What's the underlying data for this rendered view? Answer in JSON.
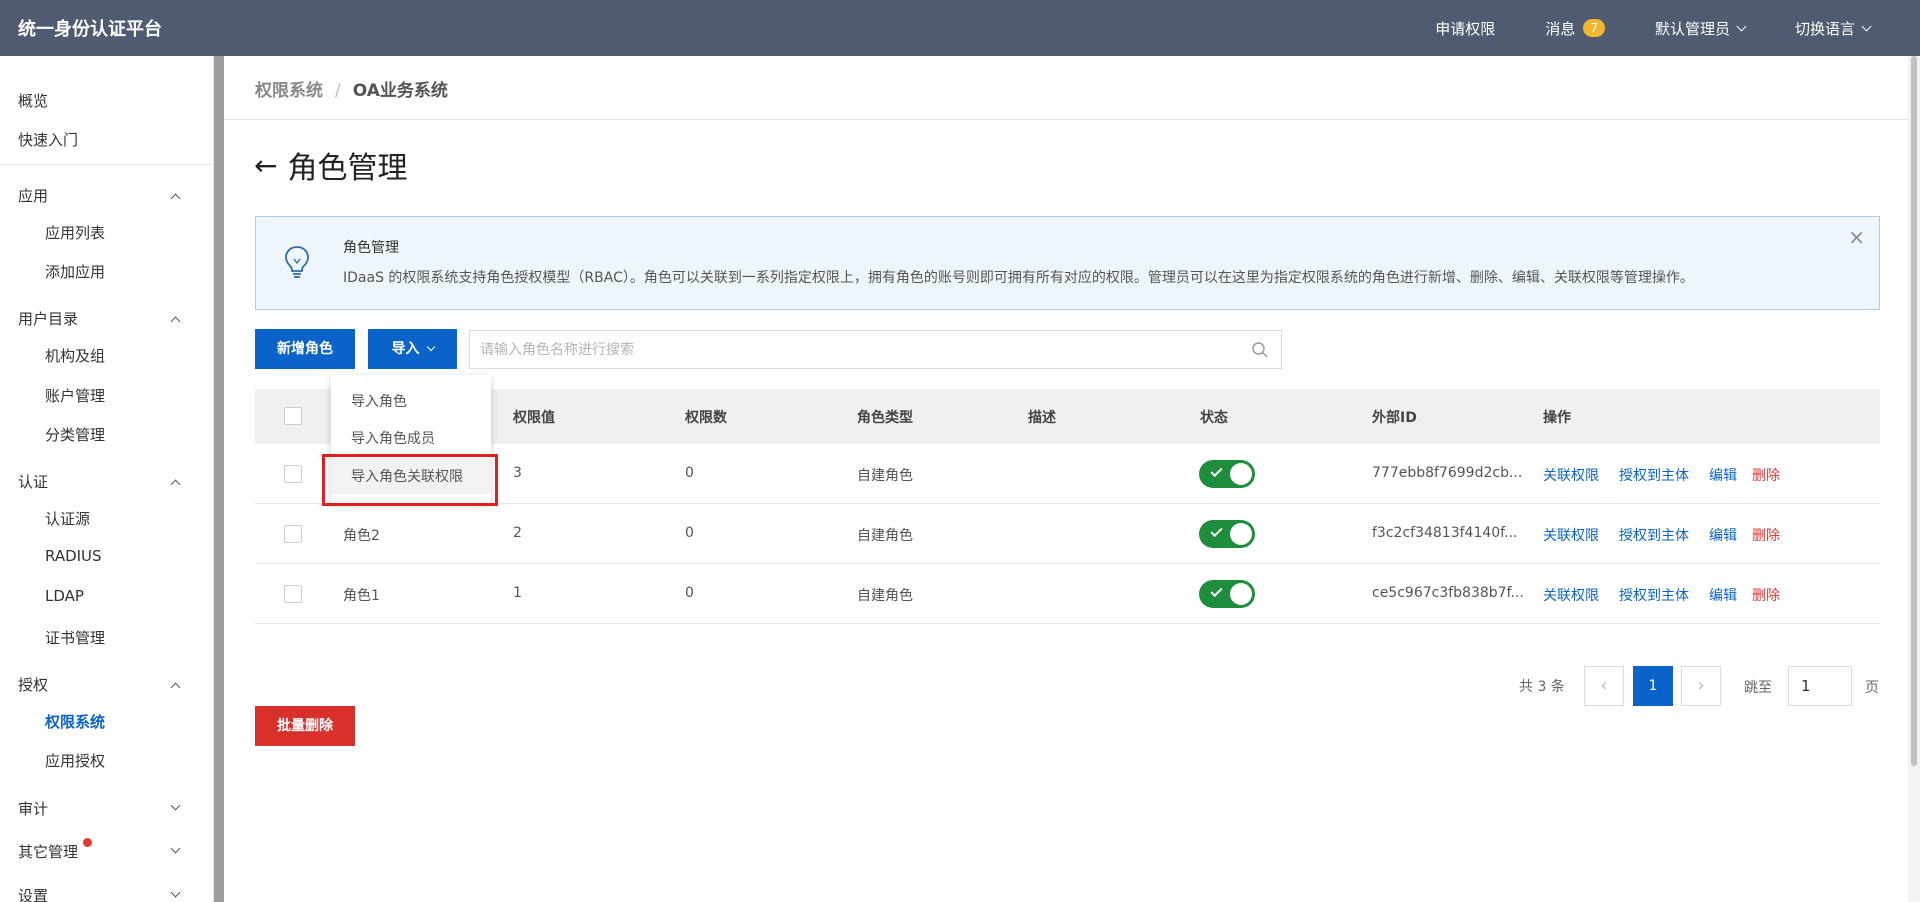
{
  "app": {
    "title": "统一身份认证平台"
  },
  "topbar": {
    "apply": "申请权限",
    "messages": "消息",
    "message_count": "7",
    "user": "默认管理员",
    "language": "切换语言"
  },
  "sidebar": {
    "overview": "概览",
    "quickstart": "快速入门",
    "groups": [
      {
        "label": "应用",
        "items": [
          "应用列表",
          "添加应用"
        ]
      },
      {
        "label": "用户目录",
        "items": [
          "机构及组",
          "账户管理",
          "分类管理"
        ]
      },
      {
        "label": "认证",
        "items": [
          "认证源",
          "RADIUS",
          "LDAP",
          "证书管理"
        ]
      },
      {
        "label": "授权",
        "items": [
          "权限系统",
          "应用授权"
        ]
      },
      {
        "label": "审计",
        "items": []
      },
      {
        "label": "其它管理",
        "items": []
      },
      {
        "label": "设置",
        "items": []
      }
    ]
  },
  "breadcrumb": {
    "parent": "权限系统",
    "separator": "/",
    "current": "OA业务系统"
  },
  "page": {
    "title": "角色管理",
    "back_arrow": "←"
  },
  "info": {
    "title": "角色管理",
    "description": "IDaaS 的权限系统支持角色授权模型（RBAC）。角色可以关联到一系列指定权限上，拥有角色的账号则即可拥有所有对应的权限。管理员可以在这里为指定权限系统的角色进行新增、删除、编辑、关联权限等管理操作。",
    "close": "×"
  },
  "toolbar": {
    "add_role": "新增角色",
    "import": "导入",
    "search_placeholder": "请输入角色名称进行搜索"
  },
  "dropdown": {
    "items": [
      "导入角色",
      "导入角色成员",
      "导入角色关联权限"
    ]
  },
  "table": {
    "headers": [
      "权限值",
      "权限数",
      "角色类型",
      "描述",
      "状态",
      "外部ID",
      "操作"
    ],
    "rows": [
      {
        "name": "",
        "value": "3",
        "count": "0",
        "type": "自建角色",
        "desc": "",
        "status": true,
        "ext_id": "777ebb8f7699d2cb..."
      },
      {
        "name": "角色2",
        "value": "2",
        "count": "0",
        "type": "自建角色",
        "desc": "",
        "status": true,
        "ext_id": "f3c2cf34813f4140f..."
      },
      {
        "name": "角色1",
        "value": "1",
        "count": "0",
        "type": "自建角色",
        "desc": "",
        "status": true,
        "ext_id": "ce5c967c3fb838b7f..."
      }
    ],
    "actions": {
      "link_perm": "关联权限",
      "grant": "授权到主体",
      "edit": "编辑",
      "delete": "删除"
    }
  },
  "pagination": {
    "total": "共 3 条",
    "page": "1",
    "goto": "跳至",
    "goto_value": "1",
    "page_unit": "页",
    "prev": "‹",
    "next": "›"
  },
  "batch_delete": "批量删除",
  "colors": {
    "topbar": "#4f5b71",
    "primary": "#0a63c9",
    "danger": "#d9302c",
    "toggle_on": "#1e8e3e",
    "badge": "#f2b62f"
  }
}
